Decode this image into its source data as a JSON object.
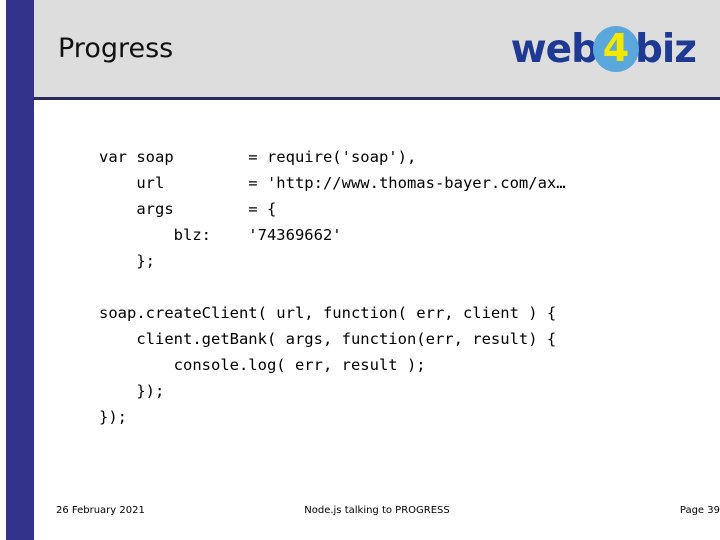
{
  "slide": {
    "title": "Progress",
    "accent_color": "#33338c",
    "header_bg": "#dddddd",
    "rule_color": "#2a2a5e",
    "background": "#ffffff"
  },
  "logo": {
    "text_left": "web",
    "badge_text": "4",
    "text_right": "biz",
    "text_color": "#1f3a93",
    "badge_circle_color": "#5aa7dc",
    "badge_text_color": "#f5e800"
  },
  "code": {
    "declarations": "var soap        = require('soap'),\n    url         = 'http://www.thomas-bayer.com/ax…\n    args        = {\n        blz:    '74369662'\n    };",
    "calls": "soap.createClient( url, function( err, client ) {\n    client.getBank( args, function(err, result) {\n        console.log( err, result );\n    });\n});"
  },
  "footer": {
    "date": "26 February 2021",
    "center": "Node.js talking to PROGRESS",
    "page": "Page 39"
  }
}
